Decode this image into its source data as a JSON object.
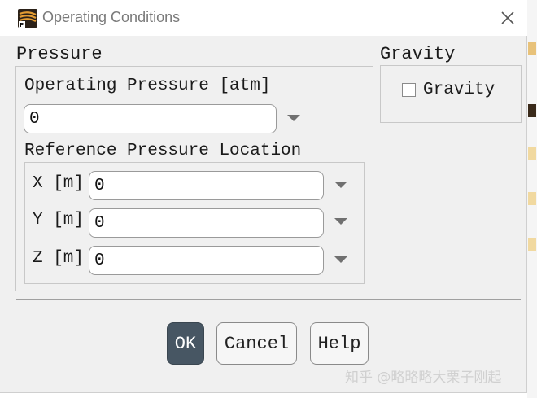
{
  "window": {
    "title": "Operating Conditions"
  },
  "pressure": {
    "group_title": "Pressure",
    "operating_label": "Operating Pressure [atm]",
    "operating_value": "0",
    "reference_title": "Reference Pressure Location",
    "x_label": "X [m]",
    "x_value": "0",
    "y_label": "Y [m]",
    "y_value": "0",
    "z_label": "Z [m]",
    "z_value": "0"
  },
  "gravity": {
    "group_title": "Gravity",
    "checkbox_label": "Gravity",
    "checked": false
  },
  "buttons": {
    "ok": "OK",
    "cancel": "Cancel",
    "help": "Help"
  },
  "watermark": "知乎 @略略略大栗子刚起",
  "colors": {
    "primary_button": "#475663",
    "dialog_bg": "#f0f0f0"
  }
}
